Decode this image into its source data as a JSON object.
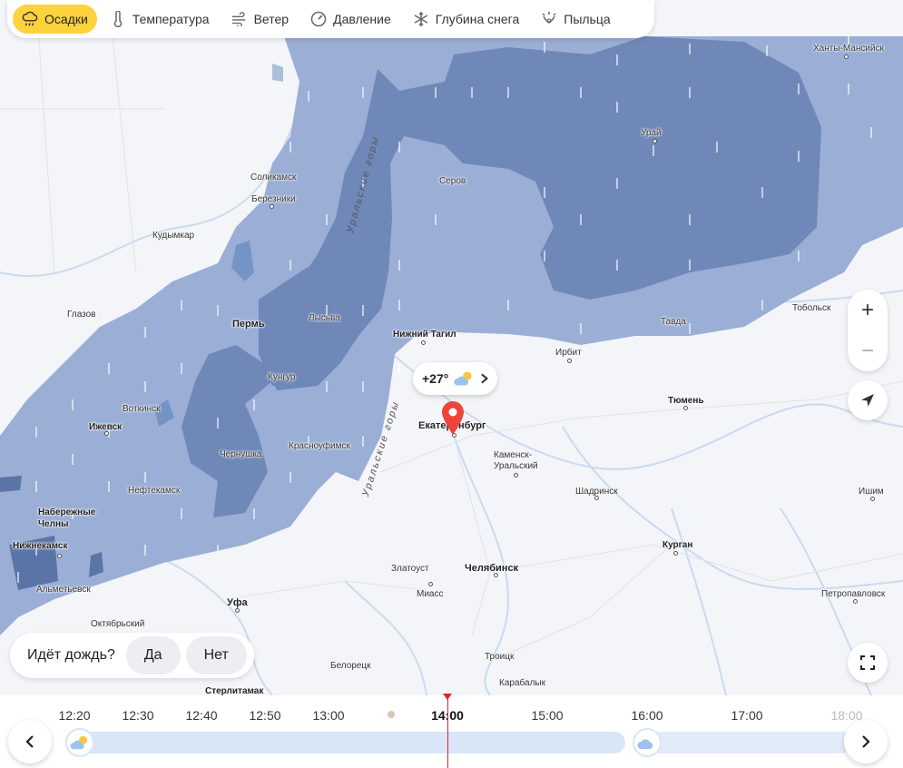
{
  "layers": {
    "tabs": [
      {
        "label": "Осадки",
        "icon": "rain-cloud-icon",
        "active": true
      },
      {
        "label": "Температура",
        "icon": "thermometer-icon",
        "active": false
      },
      {
        "label": "Ветер",
        "icon": "wind-icon",
        "active": false
      },
      {
        "label": "Давление",
        "icon": "pressure-gauge-icon",
        "active": false
      },
      {
        "label": "Глубина снега",
        "icon": "snowflake-icon",
        "active": false
      },
      {
        "label": "Пыльца",
        "icon": "pollen-icon",
        "active": false
      }
    ]
  },
  "map": {
    "cities": [
      "Ханты-Мансийск",
      "Урай",
      "Серов",
      "Соликамск",
      "Березники",
      "Кудымкар",
      "Глазов",
      "Пермь",
      "Лысьва",
      "Нижний Тагил",
      "Тобольск",
      "Тавда",
      "Ирбит",
      "Кунгур",
      "Воткинск",
      "Ижевск",
      "Тюмень",
      "Екатеринбург",
      "Каменск-Уральский",
      "Красноуфимск",
      "Чернушка",
      "Нефтекамск",
      "Шадринск",
      "Ишим",
      "Набережные Челны",
      "Нижнекамск",
      "Курган",
      "Златоуст",
      "Челябинск",
      "Миасс",
      "Альметьевск",
      "Петропавловск",
      "Уфа",
      "Октябрьский",
      "Белорецк",
      "Троицк",
      "Карабалык",
      "Стерлитамак"
    ],
    "mountain_label": "Уральские горы",
    "colors": {
      "rain_light": "#9aaed6",
      "rain_heavy": "#6f88b8",
      "rain_heaviest": "#5b74a8",
      "land": "#f4f5f8",
      "water": "#c9daf0"
    }
  },
  "weather_bubble": {
    "temp": "+27°",
    "icon": "partly-cloudy-icon"
  },
  "rain_question": {
    "question": "Идёт дождь?",
    "yes": "Да",
    "no": "Нет"
  },
  "timeline": {
    "labels": [
      "12:20",
      "12:30",
      "12:40",
      "12:50",
      "13:00",
      "14:00",
      "15:00",
      "16:00",
      "17:00",
      "18:00"
    ],
    "current": "14:00"
  },
  "controls": {
    "zoom_in": "+",
    "zoom_out": "−"
  }
}
